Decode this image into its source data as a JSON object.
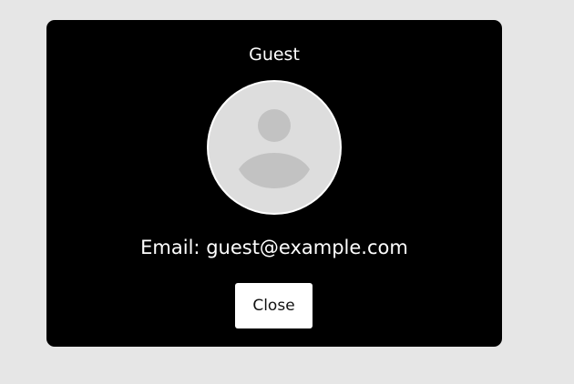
{
  "modal": {
    "title": "Guest",
    "avatar_icon": "user-placeholder-icon",
    "email_prefix": "Email:",
    "email": "guest@example.com",
    "close_label": "Close"
  },
  "colors": {
    "page_background": "#e6e6e6",
    "modal_background": "#000000",
    "text": "#ffffff",
    "avatar_background": "#dddddd",
    "avatar_figure": "#c2c2c2",
    "button_background": "#ffffff"
  }
}
